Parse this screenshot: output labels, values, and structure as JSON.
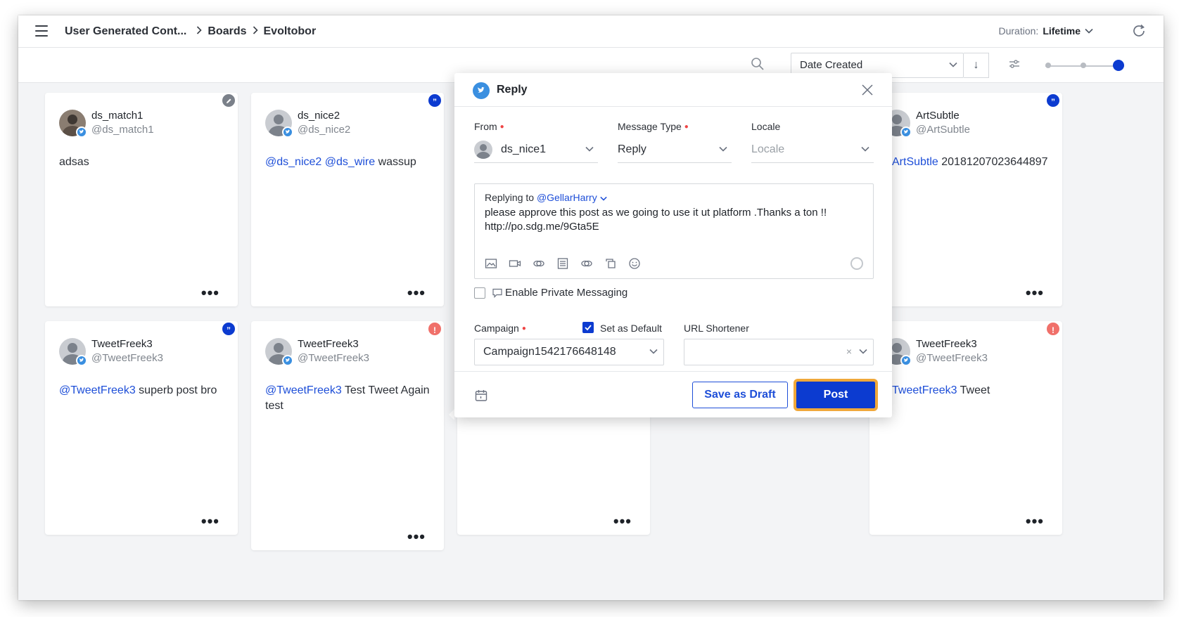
{
  "header": {
    "breadcrumb": [
      "User Generated Cont...",
      "Boards",
      "Evoltobor"
    ],
    "duration_label": "Duration:",
    "duration_value": "Lifetime"
  },
  "toolbar": {
    "sort_value": "Date Created",
    "sort_direction": "↓",
    "zoom_level_fraction": 1.0
  },
  "cards": [
    {
      "name": "ds_match1",
      "handle": "@ds_match1",
      "mentions": [],
      "text": "adsas",
      "badge": "edit",
      "more": "•••"
    },
    {
      "name": "ds_nice2",
      "handle": "@ds_nice2",
      "mentions": [
        "@ds_nice2",
        "@ds_wire"
      ],
      "text": " wassup",
      "badge": "quote",
      "more": "•••"
    },
    {
      "name": "ArtSubtle",
      "handle": "@ArtSubtle",
      "mentions": [
        "ArtSubtle"
      ],
      "text": " 20181207023644897",
      "badge": "quote",
      "more": "•••"
    },
    {
      "name": "TweetFreek3",
      "handle": "@TweetFreek3",
      "mentions": [
        "@TweetFreek3"
      ],
      "text": " superb post bro",
      "badge": "quote",
      "more": "•••"
    },
    {
      "name": "TweetFreek3",
      "handle": "@TweetFreek3",
      "mentions": [
        "@TweetFreek3"
      ],
      "text": " Test Tweet Again test",
      "badge": "alert",
      "more": "•••"
    },
    {
      "name": "",
      "handle": "",
      "mentions": [],
      "text": "",
      "badge": "",
      "more": "•••"
    },
    {
      "name": "TweetFreek3",
      "handle": "@TweetFreek3",
      "mentions": [
        "TweetFreek3"
      ],
      "text": " Tweet",
      "badge": "alert",
      "more": "•••"
    }
  ],
  "modal": {
    "title": "Reply",
    "from_label": "From",
    "from_value": "ds_nice1",
    "message_type_label": "Message Type",
    "message_type_value": "Reply",
    "locale_label": "Locale",
    "locale_placeholder": "Locale",
    "replying_prefix": "Replying to ",
    "replying_to": "@GellarHarry",
    "message_body": "please approve this post as we going to use it ut platform .Thanks a ton !! http://po.sdg.me/9Gta5E",
    "private_messaging_label": "Enable Private Messaging",
    "campaign_label": "Campaign",
    "set_default_label": "Set as Default",
    "campaign_value": "Campaign1542176648148",
    "url_shortener_label": "URL Shortener",
    "url_shortener_value": "",
    "save_draft_label": "Save as Draft",
    "post_label": "Post"
  },
  "colors": {
    "accent": "#0c3bd0",
    "link": "#1d4ed8",
    "twitter": "#3a8fe0",
    "alert_badge": "#f0706a",
    "highlight": "#f0a83a"
  }
}
